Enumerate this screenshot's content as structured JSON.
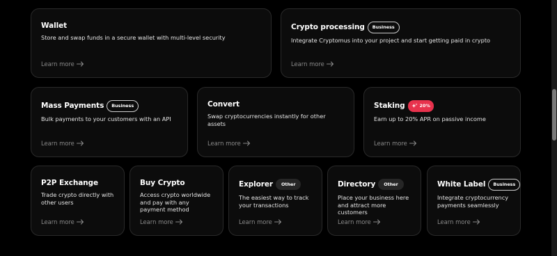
{
  "cards": {
    "wallet": {
      "title": "Wallet",
      "description": "Store and swap funds in a secure wallet with multi-level security",
      "learn_more": "Learn more"
    },
    "crypto_processing": {
      "title": "Crypto processing",
      "badge": "Business",
      "description": "Integrate Cryptomus into your project and start getting paid in crypto",
      "learn_more": "Learn more"
    },
    "mass_payments": {
      "title": "Mass Payments",
      "badge": "Business",
      "description": "Bulk payments to your customers with an API",
      "learn_more": "Learn more"
    },
    "convert": {
      "title": "Convert",
      "description": "Swap cryptocurrencies instantly for other assets",
      "learn_more": "Learn more"
    },
    "staking": {
      "title": "Staking",
      "badge": "20%",
      "description": "Earn up to 20% APR on passive income",
      "learn_more": "Learn more"
    },
    "p2p_exchange": {
      "title": "P2P Exchange",
      "description": "Trade crypto directly with other users",
      "learn_more": "Learn more"
    },
    "buy_crypto": {
      "title": "Buy Crypto",
      "description": "Access crypto worldwide and pay with any payment method",
      "learn_more": "Learn more"
    },
    "explorer": {
      "title": "Explorer",
      "badge": "Other",
      "description": "The easiest way to track your transactions",
      "learn_more": "Learn more"
    },
    "directory": {
      "title": "Directory",
      "badge": "Other",
      "description": "Place your business here and attract more customers",
      "learn_more": "Learn more"
    },
    "white_label": {
      "title": "White Label",
      "badge": "Business",
      "description": "Integrate cryptocurrency payments seamlessly",
      "learn_more": "Learn more"
    }
  },
  "icons": {
    "learn_more_arrow": "arrow-right-icon",
    "staking_badge": "sparkle-icon"
  },
  "colors": {
    "background": "#000000",
    "card_background": "#0c0c0c",
    "card_border": "#2a2a2a",
    "muted_text": "#8a8a8a",
    "hot_badge": "#e8324d",
    "other_badge": "#262626"
  }
}
